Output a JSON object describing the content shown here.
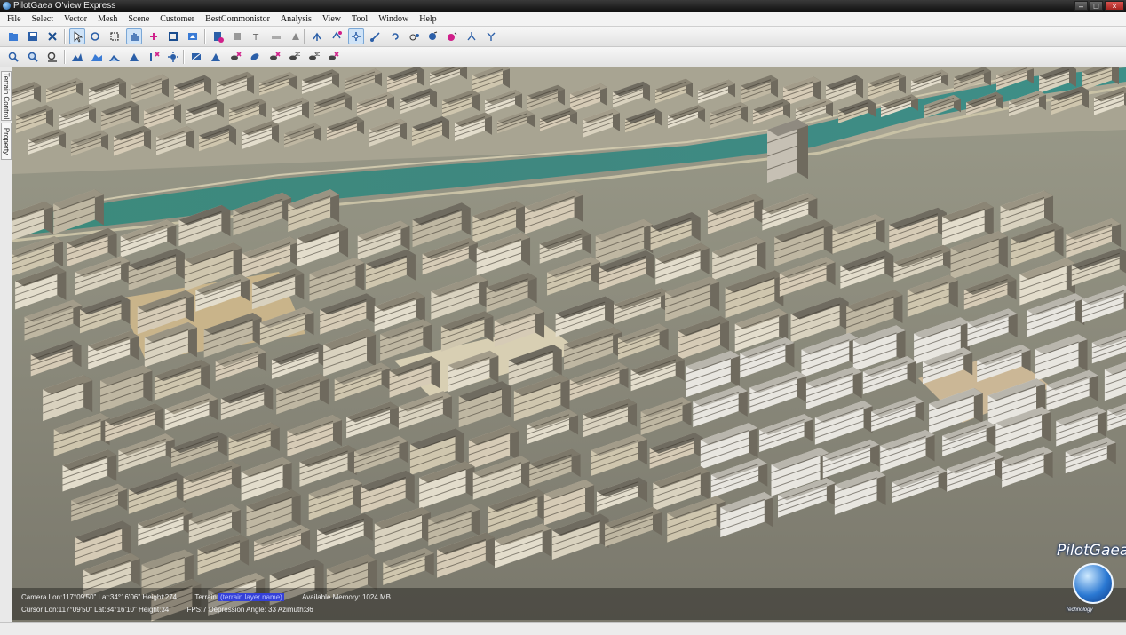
{
  "window": {
    "title": "PilotGaea O'view Express",
    "controls": [
      "–",
      "□",
      "×"
    ]
  },
  "menu": [
    "File",
    "Select",
    "Vector",
    "Mesh",
    "Scene",
    "Customer",
    "BestCommonistor",
    "Analysis",
    "View",
    "Tool",
    "Window",
    "Help"
  ],
  "toolbar1": [
    {
      "name": "open-folder-icon"
    },
    {
      "name": "save-icon"
    },
    {
      "name": "cut-icon"
    },
    {
      "name": "pointer-select-icon",
      "pressed": true
    },
    {
      "name": "lasso-select-icon"
    },
    {
      "name": "box-zoom-icon"
    },
    {
      "name": "pan-hand-icon",
      "pressed": true
    },
    {
      "name": "add-point-icon"
    },
    {
      "name": "rectangle-icon"
    },
    {
      "name": "edit-shape-icon"
    },
    {
      "name": "add-layer-icon"
    },
    {
      "name": "remove-layer-icon"
    },
    {
      "name": "text-tool-icon"
    },
    {
      "name": "eraser-icon"
    },
    {
      "name": "brush-icon"
    },
    {
      "name": "node-move-icon"
    },
    {
      "name": "node-add-icon"
    },
    {
      "name": "node-pan-icon",
      "pressed": true
    },
    {
      "name": "node-snap-icon"
    },
    {
      "name": "node-rotate-icon"
    },
    {
      "name": "node-link-icon"
    },
    {
      "name": "node-fill-icon"
    },
    {
      "name": "node-delete-icon"
    },
    {
      "name": "node-split-icon"
    },
    {
      "name": "node-merge-icon"
    }
  ],
  "toolbar2": [
    {
      "name": "measure-distance-icon"
    },
    {
      "name": "measure-area-icon"
    },
    {
      "name": "measure-height-icon"
    },
    {
      "name": "terrain-profile-icon"
    },
    {
      "name": "terrain-slope-icon"
    },
    {
      "name": "terrain-volume-icon"
    },
    {
      "name": "terrain-peak-icon"
    },
    {
      "name": "terrain-clear-icon"
    },
    {
      "name": "sun-settings-icon"
    },
    {
      "name": "viewshed-icon"
    },
    {
      "name": "triangle-icon"
    },
    {
      "name": "clear-eye-icon"
    },
    {
      "name": "flythrough-icon"
    },
    {
      "name": "clear-flythrough-icon"
    },
    {
      "name": "view-2d-icon"
    },
    {
      "name": "view-3d-icon"
    },
    {
      "name": "clear-view-icon"
    }
  ],
  "side_tabs": [
    "Terrain Control",
    "Property"
  ],
  "status": {
    "camera": "Camera Lon:117°09'50\" Lat:34°16'06\" Height:274",
    "terrain_label": "Terrain",
    "terrain_value": "(terrain layer name)",
    "memory": "Available Memory: 1024 MB",
    "cursor": "Cursor Lon:117°09'50\" Lat:34°16'10\" Height:34",
    "fps": "FPS:7  Depression Angle: 33  Azimuth:36"
  },
  "logo": {
    "text": "PilotGaea",
    "sub": "Technology"
  },
  "colors": {
    "river": "#3f8a80",
    "titlebar": "#1c1c1c",
    "terrain_highlight": "#3440d8"
  }
}
